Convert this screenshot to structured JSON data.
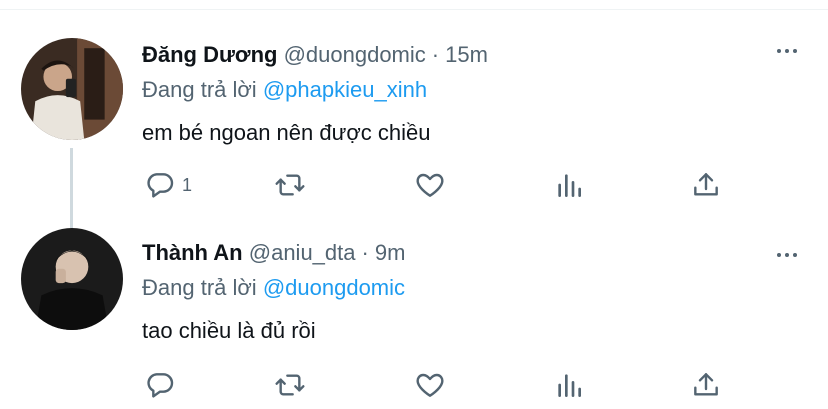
{
  "tweets": [
    {
      "name": "Đăng Dương",
      "handle": "@duongdomic",
      "separator": "·",
      "time": "15m",
      "replying_prefix": "Đang trả lời",
      "replying_to": "@phapkieu_xinh",
      "text": "em bé ngoan nên được chiều",
      "reply_count": "1"
    },
    {
      "name": "Thành An",
      "handle": "@aniu_dta",
      "separator": "·",
      "time": "9m",
      "replying_prefix": "Đang trả lời",
      "replying_to": "@duongdomic",
      "text": "tao chiều là đủ rồi",
      "reply_count": ""
    }
  ],
  "icons": [
    "reply-icon",
    "retweet-icon",
    "like-icon",
    "stats-icon",
    "share-icon",
    "more-icon"
  ],
  "colors": {
    "link": "#1d9bf0",
    "muted": "#536471",
    "text": "#0f1419",
    "thread_line": "#cfd9de"
  }
}
